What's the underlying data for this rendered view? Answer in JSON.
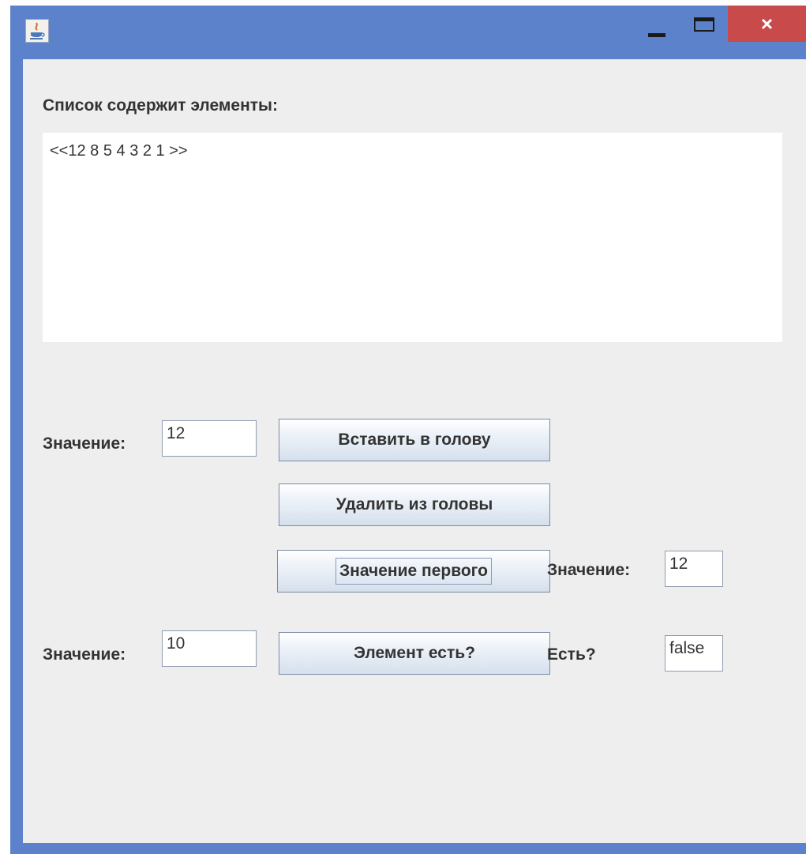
{
  "window": {
    "controls": {
      "close": "×"
    }
  },
  "list_label": "Список содержит элементы:",
  "list_content": "<<12 8 5 4 3 2 1 >>",
  "insert_row": {
    "label": "Значение:",
    "value": "12",
    "button": "Вставить в голову"
  },
  "delete_button": "Удалить из головы",
  "first_row": {
    "button": "Значение первого",
    "label": "Значение:",
    "value": "12"
  },
  "contains_row": {
    "label": "Значение:",
    "value": "10",
    "button": "Элемент есть?",
    "result_label": "Есть?",
    "result_value": "false"
  },
  "colors": {
    "titlebar": "#5d82cc",
    "close": "#c84a4a",
    "background": "#eeeeee"
  },
  "icons": [
    "java-app-icon",
    "minimize-icon",
    "maximize-icon",
    "close-icon"
  ]
}
